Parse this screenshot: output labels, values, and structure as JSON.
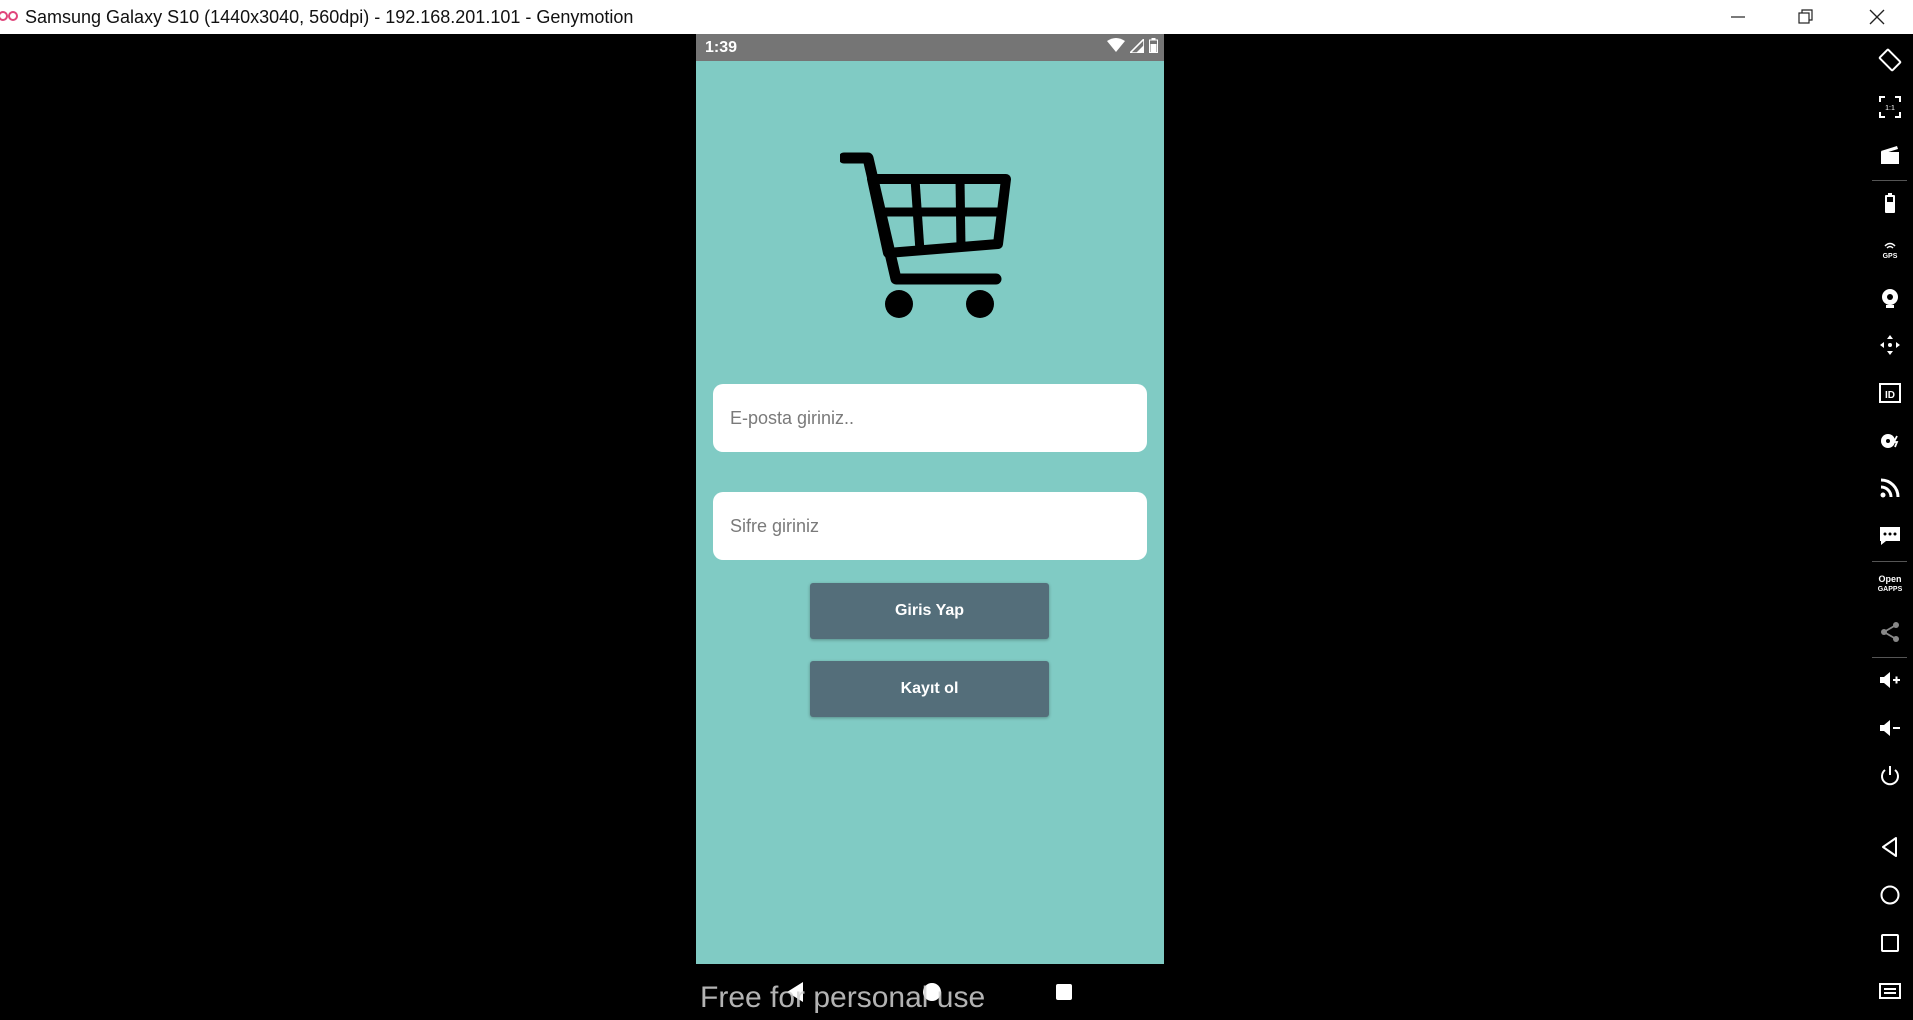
{
  "window": {
    "title": "Samsung Galaxy S10 (1440x3040, 560dpi) - 192.168.201.101 - Genymotion",
    "controls": [
      "minimize-icon",
      "restore-icon",
      "close-icon"
    ]
  },
  "status_bar": {
    "time": "1:39",
    "icons": [
      "wifi-icon",
      "signal-icon",
      "battery-icon"
    ]
  },
  "app": {
    "background_color": "#80CBC4",
    "logo_icon": "shopping-cart-icon",
    "email": {
      "placeholder": "E-posta giriniz..",
      "value": ""
    },
    "password": {
      "placeholder": "Sifre giriniz",
      "value": ""
    },
    "login_button": "Giris Yap",
    "register_button": "Kayıt ol",
    "button_color": "#546E7A"
  },
  "nav_bar": {
    "icons": [
      "back-icon",
      "home-icon",
      "recents-icon"
    ],
    "watermark": "Free for personal use"
  },
  "toolbar": {
    "tools": [
      {
        "name": "rotate-icon"
      },
      {
        "name": "pixel-perfect-icon",
        "label": "1:1"
      },
      {
        "name": "capture-icon"
      },
      {
        "name": "battery-icon"
      },
      {
        "name": "gps-icon",
        "label": "GPS"
      },
      {
        "name": "camera-icon"
      },
      {
        "name": "dpad-icon"
      },
      {
        "name": "identifiers-icon",
        "label": "ID"
      },
      {
        "name": "disk-io-icon"
      },
      {
        "name": "network-icon"
      },
      {
        "name": "phone-sms-icon"
      },
      {
        "name": "open-gapps-icon",
        "label": "Open GAPPS"
      },
      {
        "name": "share-icon"
      },
      {
        "name": "volume-up-icon"
      },
      {
        "name": "volume-down-icon"
      },
      {
        "name": "power-icon"
      },
      {
        "name": "back-icon"
      },
      {
        "name": "home-icon"
      },
      {
        "name": "recent-apps-icon"
      },
      {
        "name": "menu-icon"
      }
    ]
  }
}
